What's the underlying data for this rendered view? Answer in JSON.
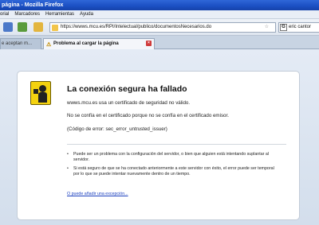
{
  "window": {
    "title": "página - Mozilla Firefox"
  },
  "menu": [
    "orial",
    "Marcadores",
    "Herramientas",
    "Ayuda"
  ],
  "nav": {
    "url": "https://wwws.mcu.es/RPI/Intelectual/publico/documentosNecesarios.do",
    "search_text": "eric cantor"
  },
  "tabs": [
    {
      "label": "e aceptan m...",
      "active": false
    },
    {
      "label": "Problema al cargar la página",
      "active": true
    }
  ],
  "error": {
    "title": "La conexión segura ha fallado",
    "line1": "wwws.mcu.es usa un certificado de seguridad no válido.",
    "line2": "No se confía en el certificado porque no se confía en el certificado emisor.",
    "line3": "(Código de error: sec_error_untrusted_issuer)",
    "bullet1": "Puede ser un problema con la configuración del servidor, o bien que alguien está intentando suplantar al servidor.",
    "bullet2": "Si está seguro de que se ha conectado anteriormente a este servidor con éxito, el error puede ser temporal por lo que se puede intentar nuevamente dentro de un tiempo.",
    "link": "O puede añadir una excepción..."
  }
}
